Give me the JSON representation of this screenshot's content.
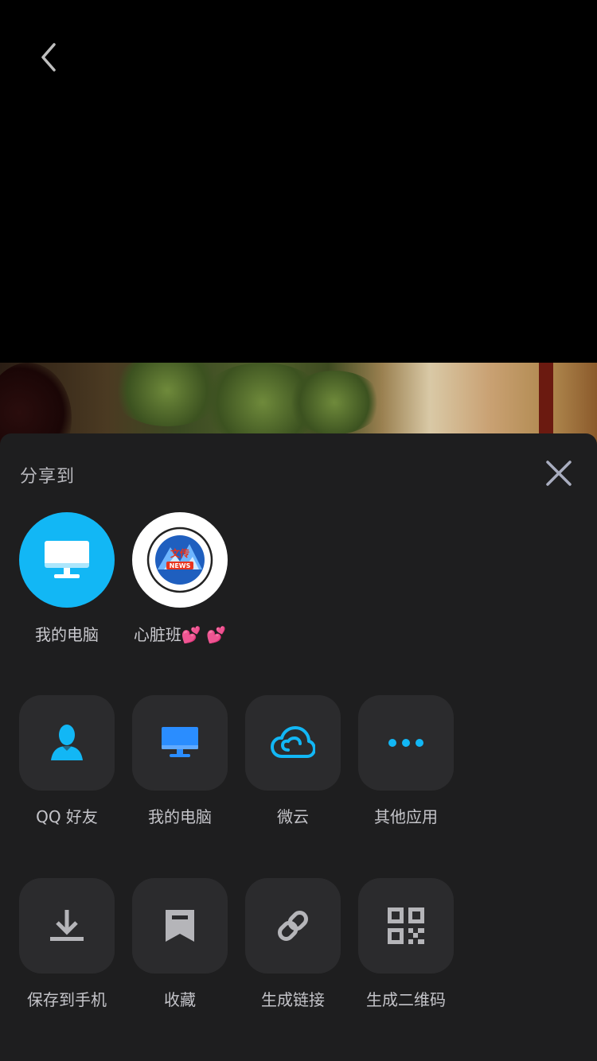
{
  "header": {
    "back_icon": "chevron-left-icon"
  },
  "share_sheet": {
    "title": "分享到",
    "close_icon": "close-icon",
    "recent": [
      {
        "label": "我的电脑",
        "icon": "monitor-icon",
        "bg": "#12B7F5"
      },
      {
        "label": "心脏班💕 💕",
        "icon": "news-logo-avatar",
        "bg": "#FFFFFF",
        "logo_text": "文传",
        "logo_badge": "NEWS"
      }
    ],
    "row1": [
      {
        "label": "QQ 好友",
        "icon": "qq-friend-icon"
      },
      {
        "label": "我的电脑",
        "icon": "monitor-icon"
      },
      {
        "label": "微云",
        "icon": "cloud-icon"
      },
      {
        "label": "其他应用",
        "icon": "more-icon"
      }
    ],
    "row2": [
      {
        "label": "保存到手机",
        "icon": "download-icon"
      },
      {
        "label": "收藏",
        "icon": "bookmark-icon"
      },
      {
        "label": "生成链接",
        "icon": "link-icon"
      },
      {
        "label": "生成二维码",
        "icon": "qrcode-icon"
      }
    ]
  },
  "colors": {
    "accent": "#12B7F5",
    "sheet_bg": "#1E1E1F",
    "tile_bg": "#2B2B2D",
    "gray_icon": "#A6A6AA"
  }
}
